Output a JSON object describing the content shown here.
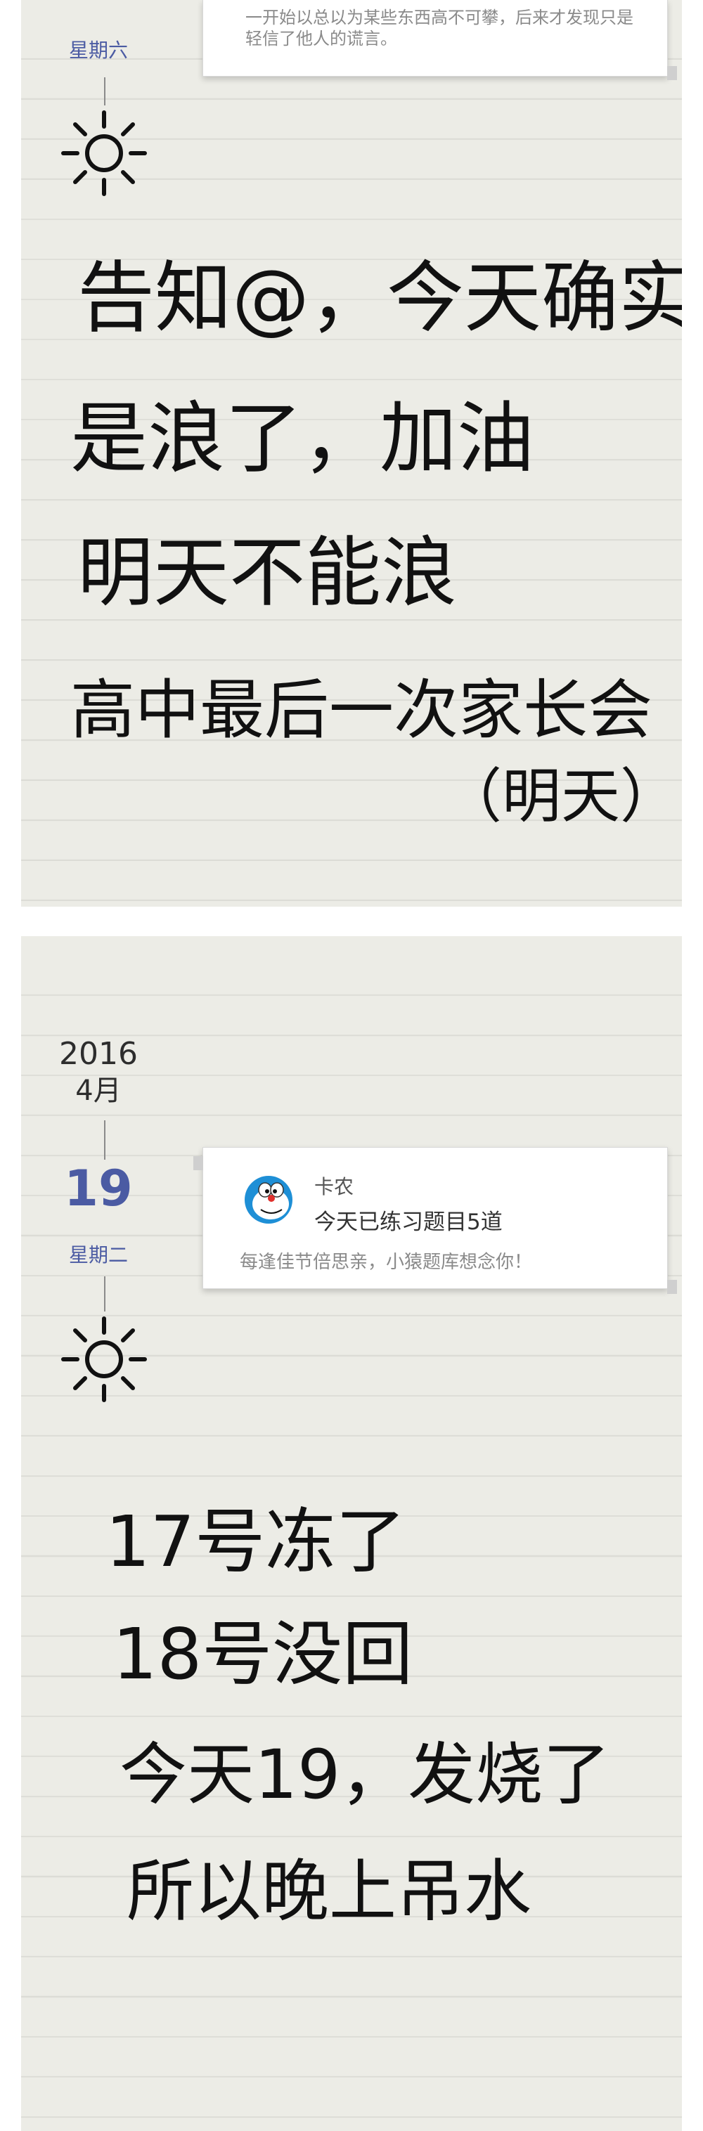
{
  "entries": [
    {
      "weekday": "星期六",
      "note": {
        "description": "一开始以总以为某些东西高不可攀，后来才发现只是轻信了他人的谎言。"
      },
      "weather_icon": "sun-icon",
      "handwriting": [
        "告知@，今天确实",
        "是浪了，加油",
        "明天不能浪",
        "高中最后一次家长会",
        "（明天）"
      ]
    },
    {
      "year": "2016",
      "month": "4月",
      "day": "19",
      "weekday": "星期二",
      "note": {
        "name": "卡农",
        "title": "今天已练习题目5道",
        "description": "每逢佳节倍思亲，小猿题库想念你！",
        "avatar_icon": "doraemon-avatar-icon"
      },
      "weather_icon": "sun-icon",
      "handwriting": [
        "17号冻了",
        "18号没回",
        "今天19，发烧了",
        "所以晚上吊水"
      ]
    }
  ],
  "colors": {
    "accent": "#4b5ba3",
    "paper": "#ecece6",
    "ink": "#111111"
  }
}
